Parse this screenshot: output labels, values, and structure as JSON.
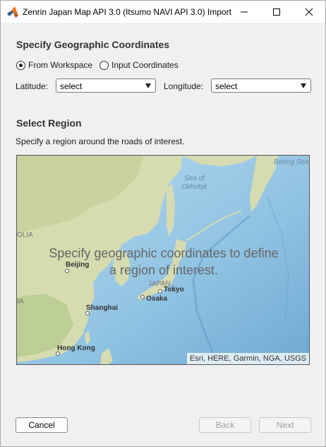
{
  "window": {
    "title": "Zenrin Japan Map API 3.0 (Itsumo NAVI API 3.0) Import"
  },
  "coords_section": {
    "heading": "Specify Geographic Coordinates",
    "radio_workspace": "From Workspace",
    "radio_input": "Input Coordinates",
    "selected_radio": "From Workspace",
    "latitude_label": "Latitude:",
    "latitude_value": "select",
    "longitude_label": "Longitude:",
    "longitude_value": "select"
  },
  "region_section": {
    "heading": "Select Region",
    "description": "Specify a region around the roads of interest."
  },
  "map": {
    "message_line1": "Specify geographic coordinates to define",
    "message_line2": "a region of interest.",
    "attribution": "Esri, HERE, Garmin, NGA, USGS",
    "labels": {
      "sea_okhotsk_1": "Sea of",
      "sea_okhotsk_2": "Okhotsk",
      "bering": "Bering Sea",
      "olia": "OLIA",
      "ia": "IA",
      "beijing": "Beijing",
      "japan": "JAPAN",
      "tokyo": "Tokyo",
      "osaka": "Osaka",
      "shanghai": "Shanghai",
      "hongkong": "Hong Kong"
    },
    "colors": {
      "land": "#d9dcb6",
      "land_dark": "#b9c79a",
      "water": "#a9d0e8",
      "deep_water": "#7ab3d8"
    }
  },
  "buttons": {
    "cancel": "Cancel",
    "back": "Back",
    "next": "Next"
  },
  "icons": {
    "app": "matlab-icon",
    "minimize": "minimize-icon",
    "maximize": "maximize-icon",
    "close": "close-icon"
  }
}
